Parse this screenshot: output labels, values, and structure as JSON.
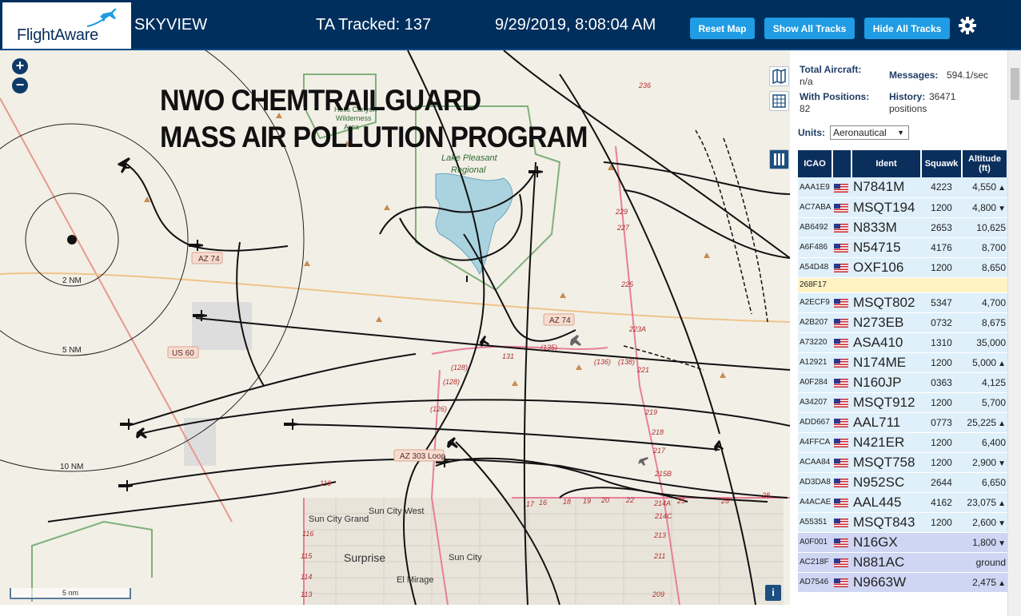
{
  "header": {
    "logo_text": "FlightAware",
    "title": "SKYVIEW",
    "tracked": "TA Tracked: 137",
    "datetime": "9/29/2019, 8:08:04 AM",
    "buttons": {
      "reset": "Reset Map",
      "show_all": "Show All Tracks",
      "hide_all": "Hide All Tracks"
    }
  },
  "map": {
    "overlay_title_line1": "NWO CHEMTRAILGUARD",
    "overlay_title_line2": "MASS AIR POLLUTION PROGRAM",
    "scale_label": "5 nm",
    "range_rings": [
      "2 NM",
      "5 NM",
      "10 NM"
    ],
    "road_labels": [
      "AZ 74",
      "AZ 74",
      "US 60",
      "AZ 303 Loop"
    ],
    "place_labels": [
      "Hells Canyon Wilderness Area",
      "Lake Pleasant Regional Park",
      "Sun City West",
      "Sun City Grand",
      "Surprise",
      "Sun City",
      "El Mirage"
    ],
    "route_numbers": [
      "236",
      "229",
      "227",
      "225",
      "223A",
      "221",
      "219",
      "218",
      "217",
      "215B",
      "214A",
      "214C",
      "213",
      "211",
      "209",
      "119",
      "116",
      "115",
      "114",
      "113",
      "112",
      "111",
      "17",
      "16",
      "18",
      "19",
      "20",
      "22",
      "23",
      "24",
      "25",
      "26",
      "28",
      "128",
      "127",
      "126",
      "125",
      "131",
      "135",
      "136",
      "138"
    ],
    "controls": {
      "zoom_in": "+",
      "zoom_out": "−",
      "info": "i"
    }
  },
  "sidebar": {
    "total_aircraft_label": "Total Aircraft:",
    "total_aircraft_value": "n/a",
    "with_positions_label": "With Positions:",
    "with_positions_value": "82",
    "messages_label": "Messages:",
    "messages_value": "594.1/sec",
    "history_label": "History:",
    "history_value": "36471",
    "history_unit": "positions",
    "units_label": "Units:",
    "units_value": "Aeronautical",
    "columns": [
      "ICAO",
      "",
      "Ident",
      "Squawk",
      "Altitude (ft)"
    ],
    "rows": [
      {
        "icao": "AAA1E9",
        "ident": "N7841M",
        "squawk": "4223",
        "alt": "4,550",
        "trend": "▲",
        "style": "r"
      },
      {
        "icao": "AC7ABA",
        "ident": "MSQT194",
        "squawk": "1200",
        "alt": "4,800",
        "trend": "▼",
        "style": "r"
      },
      {
        "icao": "AB6492",
        "ident": "N833M",
        "squawk": "2653",
        "alt": "10,625",
        "trend": "",
        "style": "r"
      },
      {
        "icao": "A6F486",
        "ident": "N54715",
        "squawk": "4176",
        "alt": "8,700",
        "trend": "",
        "style": "r"
      },
      {
        "icao": "A54D48",
        "ident": "OXF106",
        "squawk": "1200",
        "alt": "8,650",
        "trend": "",
        "style": "r"
      },
      {
        "icao": "268F17",
        "ident": "",
        "squawk": "",
        "alt": "",
        "trend": "",
        "style": "hl"
      },
      {
        "icao": "A2ECF9",
        "ident": "MSQT802",
        "squawk": "5347",
        "alt": "4,700",
        "trend": "",
        "style": "r"
      },
      {
        "icao": "A2B207",
        "ident": "N273EB",
        "squawk": "0732",
        "alt": "8,675",
        "trend": "",
        "style": "r"
      },
      {
        "icao": "A73220",
        "ident": "ASA410",
        "squawk": "1310",
        "alt": "35,000",
        "trend": "",
        "style": "r"
      },
      {
        "icao": "A12921",
        "ident": "N174ME",
        "squawk": "1200",
        "alt": "5,000",
        "trend": "▲",
        "style": "r"
      },
      {
        "icao": "A0F284",
        "ident": "N160JP",
        "squawk": "0363",
        "alt": "4,125",
        "trend": "",
        "style": "r"
      },
      {
        "icao": "A34207",
        "ident": "MSQT912",
        "squawk": "1200",
        "alt": "5,700",
        "trend": "",
        "style": "r"
      },
      {
        "icao": "ADD667",
        "ident": "AAL711",
        "squawk": "0773",
        "alt": "25,225",
        "trend": "▲",
        "style": "r"
      },
      {
        "icao": "A4FFCA",
        "ident": "N421ER",
        "squawk": "1200",
        "alt": "6,400",
        "trend": "",
        "style": "r"
      },
      {
        "icao": "ACAA84",
        "ident": "MSQT758",
        "squawk": "1200",
        "alt": "2,900",
        "trend": "▼",
        "style": "r"
      },
      {
        "icao": "AD3DA8",
        "ident": "N952SC",
        "squawk": "2644",
        "alt": "6,650",
        "trend": "",
        "style": "r"
      },
      {
        "icao": "A4ACAE",
        "ident": "AAL445",
        "squawk": "4162",
        "alt": "23,075",
        "trend": "▲",
        "style": "r"
      },
      {
        "icao": "A55351",
        "ident": "MSQT843",
        "squawk": "1200",
        "alt": "2,600",
        "trend": "▼",
        "style": "r"
      },
      {
        "icao": "A0F001",
        "ident": "N16GX",
        "squawk": "",
        "alt": "1,800",
        "trend": "▼",
        "style": "nolog"
      },
      {
        "icao": "AC218F",
        "ident": "N881AC",
        "squawk": "",
        "alt": "ground",
        "trend": "",
        "style": "nolog"
      },
      {
        "icao": "AD7546",
        "ident": "N9663W",
        "squawk": "",
        "alt": "2,475",
        "trend": "▲",
        "style": "nolog"
      }
    ]
  },
  "colors": {
    "header_bg": "#002f5d",
    "button_bg": "#1f9ce3",
    "table_header": "#0b2f5c",
    "row_bg": "#dff0fb",
    "highlight_row": "#fff3c4",
    "nolog_row": "#cfd6f4",
    "map_bg": "#f2efe7"
  }
}
